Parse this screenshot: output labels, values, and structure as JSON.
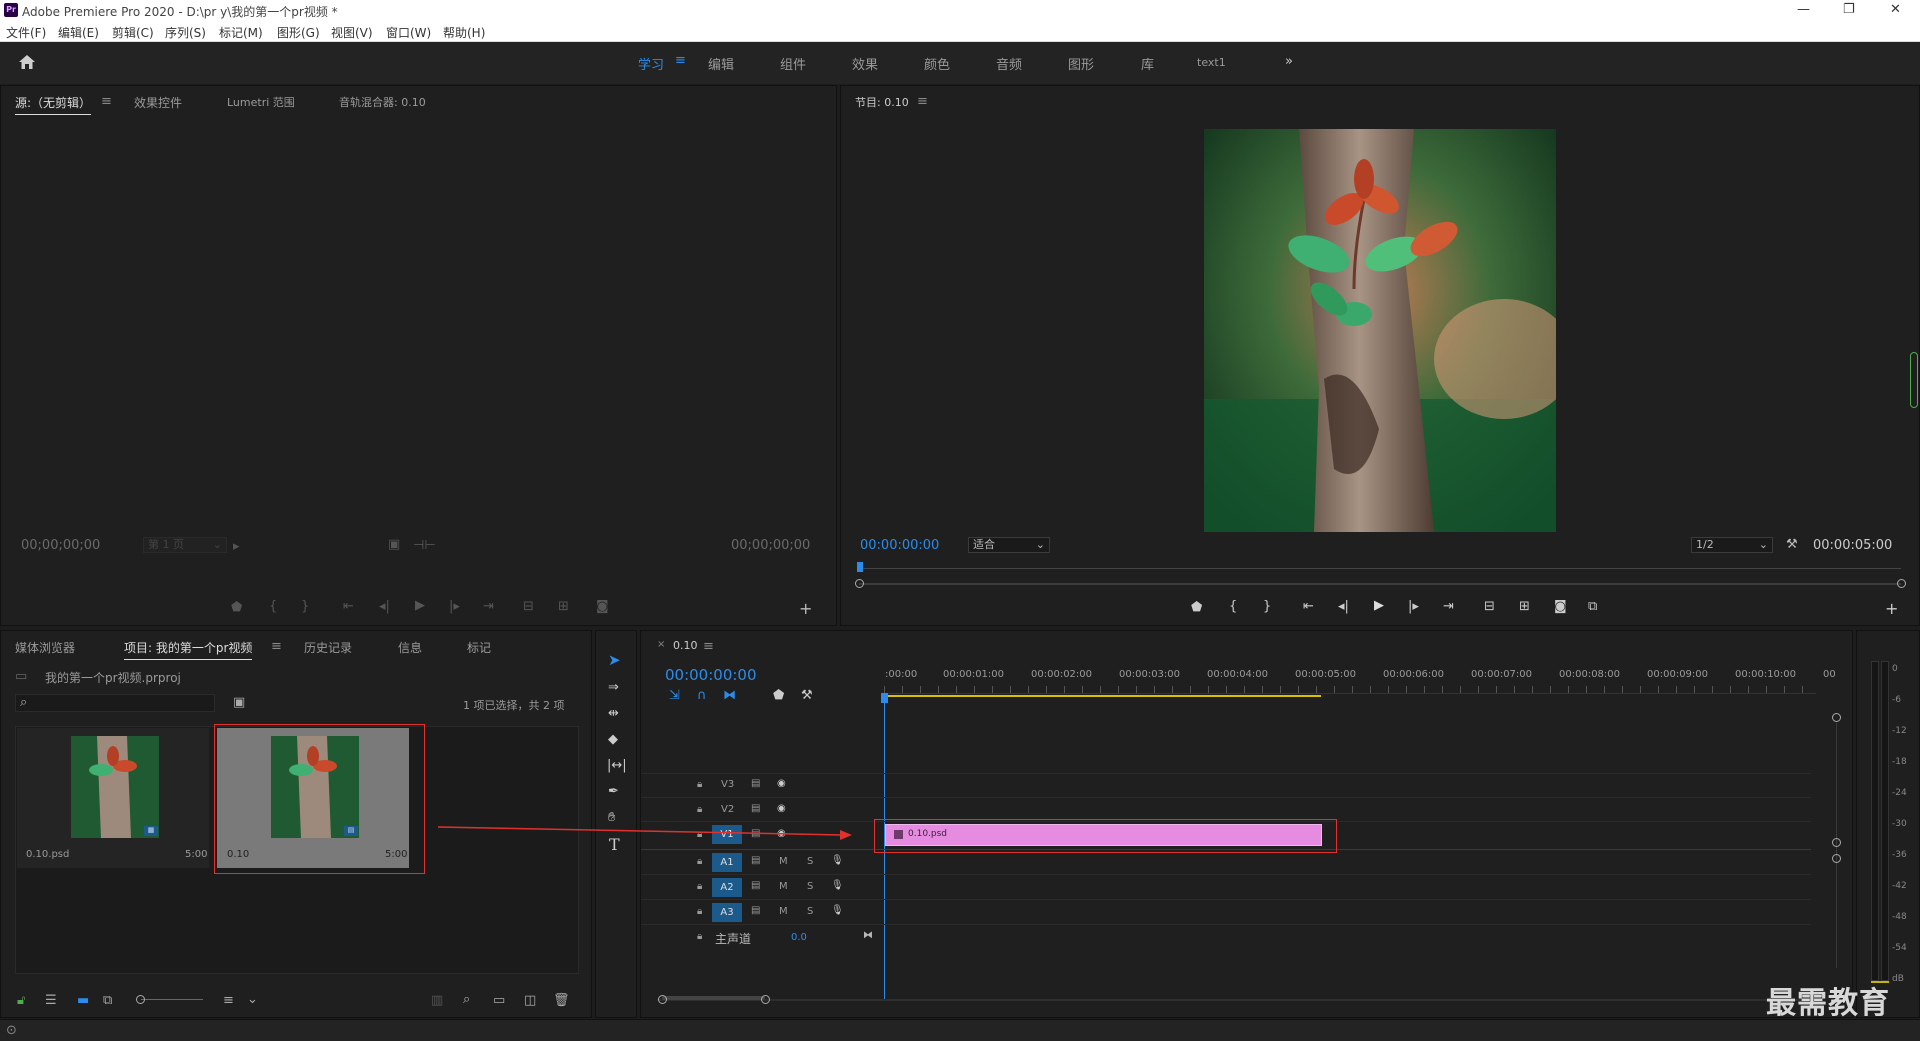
{
  "window": {
    "title": "Adobe Premiere Pro 2020 - D:\\pr y\\我的第一个pr视频 *",
    "app_icon": "Pr",
    "minimize": "—",
    "restore": "❐",
    "close": "✕"
  },
  "menu": [
    "文件(F)",
    "编辑(E)",
    "剪辑(C)",
    "序列(S)",
    "标记(M)",
    "图形(G)",
    "视图(V)",
    "窗口(W)",
    "帮助(H)"
  ],
  "workspaces": [
    "学习",
    "编辑",
    "组件",
    "效果",
    "颜色",
    "音频",
    "图形",
    "库",
    "text1"
  ],
  "source_panel": {
    "tabs": [
      "源:（无剪辑）",
      "效果控件",
      "Lumetri 范围",
      "音轨混合器: 0.10"
    ],
    "timecode_in": "00;00;00;00",
    "timecode_out": "00;00;00;00",
    "page_select": "第 1 页"
  },
  "program_panel": {
    "title": "节目: 0.10",
    "timecode_current": "00:00:00:00",
    "fit_select": "适合",
    "resolution_select": "1/2",
    "timecode_duration": "00:00:05:00"
  },
  "project_panel": {
    "tabs": [
      "媒体浏览器",
      "项目: 我的第一个pr视频",
      "历史记录",
      "信息",
      "标记"
    ],
    "project_file": "我的第一个pr视频.prproj",
    "selection_status": "1 项已选择，共 2 项",
    "items": [
      {
        "name": "0.10.psd",
        "duration": "5:00"
      },
      {
        "name": "0.10",
        "duration": "5:00"
      }
    ]
  },
  "timeline": {
    "sequence_tab": "0.10",
    "timecode": "00:00:00:00",
    "ruler": [
      ":00:00",
      "00:00:01:00",
      "00:00:02:00",
      "00:00:03:00",
      "00:00:04:00",
      "00:00:05:00",
      "00:00:06:00",
      "00:00:07:00",
      "00:00:08:00",
      "00:00:09:00",
      "00:00:10:00",
      "00"
    ],
    "video_tracks": [
      "V3",
      "V2",
      "V1"
    ],
    "audio_tracks": [
      "A1",
      "A2",
      "A3"
    ],
    "track_mute": "M",
    "track_solo": "S",
    "master_label": "主声道",
    "master_value": "0.0",
    "clip_name": "0.10.psd",
    "clip_color": "#e58ce0"
  },
  "audio_meter": {
    "labels": [
      "0",
      "-6",
      "-12",
      "-18",
      "-24",
      "-30",
      "-36",
      "-42",
      "-48",
      "-54",
      "dB"
    ]
  },
  "watermark": "最需教育",
  "colors": {
    "accent": "#2d8ceb",
    "highlight_box": "#e0312f",
    "arrow": "#e0312f"
  }
}
